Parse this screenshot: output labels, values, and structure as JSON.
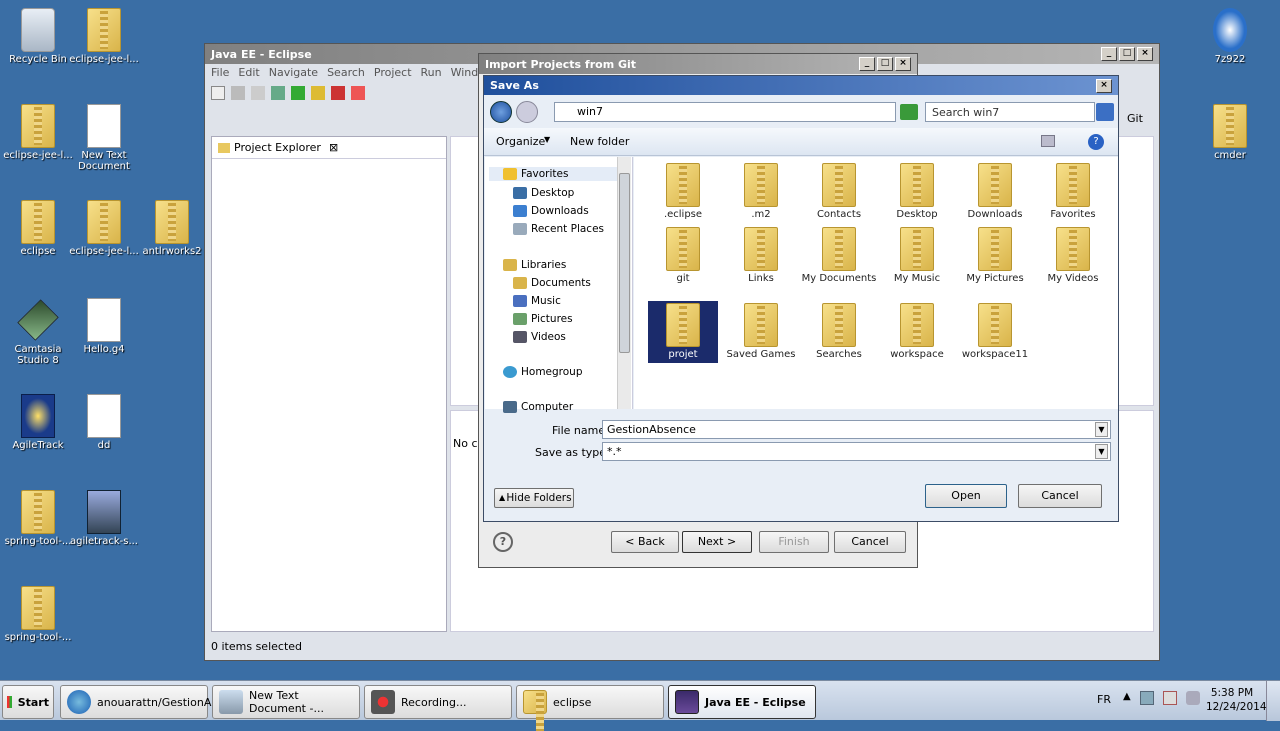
{
  "desktop": {
    "icons": [
      {
        "label": "Recycle Bin",
        "icon": "recycle-bin-icon"
      },
      {
        "label": "eclipse-jee-l...",
        "icon": "folder-icon"
      },
      {
        "label": "eclipse-jee-l...",
        "icon": "folder-icon"
      },
      {
        "label": "New Text Document",
        "icon": "text-document-icon"
      },
      {
        "label": "eclipse",
        "icon": "folder-icon"
      },
      {
        "label": "eclipse-jee-l...",
        "icon": "folder-icon"
      },
      {
        "label": "antlrworks2",
        "icon": "folder-icon"
      },
      {
        "label": "Camtasia Studio 8",
        "icon": "camtasia-icon"
      },
      {
        "label": "Hello.g4",
        "icon": "file-icon"
      },
      {
        "label": "AgileTrack",
        "icon": "agiletrack-icon"
      },
      {
        "label": "dd",
        "icon": "java-file-icon"
      },
      {
        "label": "spring-tool-...",
        "icon": "folder-icon"
      },
      {
        "label": "agiletrack-s...",
        "icon": "installer-icon"
      },
      {
        "label": "spring-tool-...",
        "icon": "folder-icon"
      },
      {
        "label": "7z922",
        "icon": "installer-icon"
      },
      {
        "label": "cmder",
        "icon": "folder-icon"
      }
    ]
  },
  "eclipse": {
    "title": "Java EE - Eclipse",
    "menu": [
      "File",
      "Edit",
      "Navigate",
      "Search",
      "Project",
      "Run",
      "Window"
    ],
    "project_explorer": "Project Explorer",
    "status": "0 items selected",
    "git_tab": "Git",
    "console_text": "No co"
  },
  "import_dialog": {
    "title": "Import Projects from Git",
    "back": "< Back",
    "next": "Next >",
    "finish": "Finish",
    "cancel": "Cancel"
  },
  "save_as": {
    "title": "Save As",
    "path": "win7",
    "search_placeholder": "Search win7",
    "organize": "Organize",
    "new_folder": "New folder",
    "nav": {
      "favorites": "Favorites",
      "desktop": "Desktop",
      "downloads": "Downloads",
      "recent_places": "Recent Places",
      "libraries": "Libraries",
      "documents": "Documents",
      "music": "Music",
      "pictures": "Pictures",
      "videos": "Videos",
      "homegroup": "Homegroup",
      "computer": "Computer"
    },
    "folders": [
      ".eclipse",
      ".m2",
      "Contacts",
      "Desktop",
      "Downloads",
      "Favorites",
      "git",
      "Links",
      "My Documents",
      "My Music",
      "My Pictures",
      "My Videos",
      "projet",
      "Saved Games",
      "Searches",
      "workspace",
      "workspace11"
    ],
    "file_name_label": "File name:",
    "file_name": "GestionAbsence",
    "type_label": "Save as type:",
    "type_value": "*.*",
    "hide_folders": "Hide Folders",
    "open": "Open",
    "cancel": "Cancel"
  },
  "taskbar": {
    "start": "Start",
    "items": [
      "anouarattn/GestionA...",
      "New Text Document -...",
      "Recording...",
      "eclipse",
      "Java EE - Eclipse"
    ],
    "lang": "FR",
    "time": "5:38 PM",
    "date": "12/24/2014"
  }
}
